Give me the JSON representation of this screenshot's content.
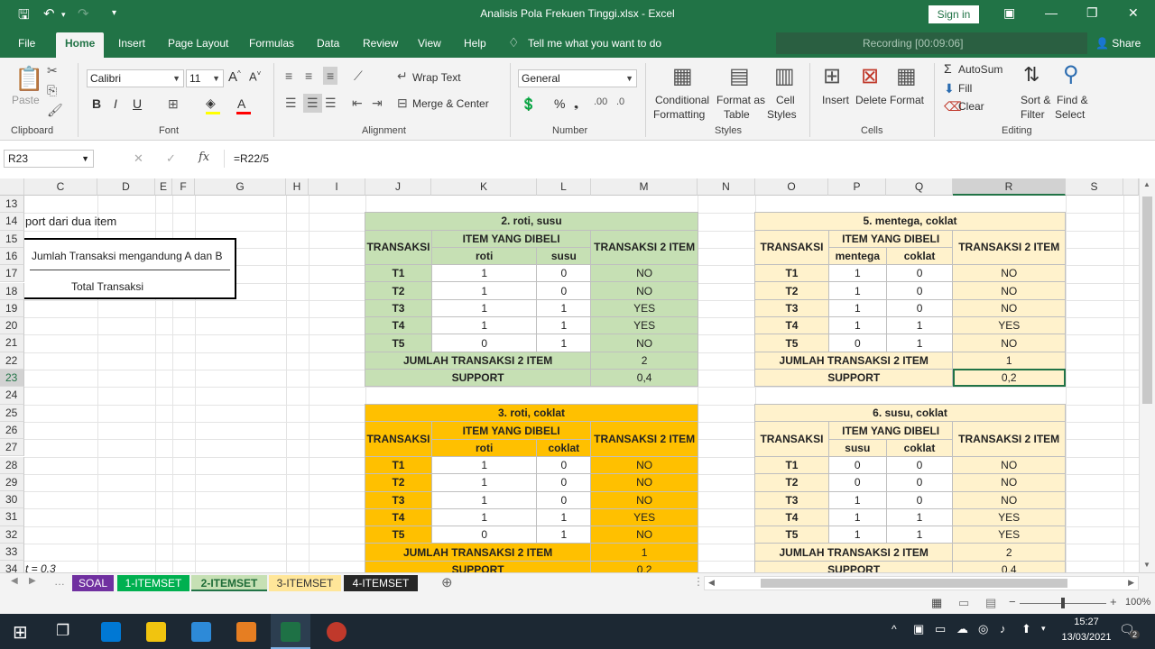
{
  "window": {
    "title": "Analisis Pola Frekuen Tinggi.xlsx  -  Excel",
    "signin": "Sign in"
  },
  "ribbon_tabs": [
    "File",
    "Home",
    "Insert",
    "Page Layout",
    "Formulas",
    "Data",
    "Review",
    "View",
    "Help"
  ],
  "tellme": "Tell me what you want to do",
  "recording": "Recording [00:09:06]",
  "share": "Share",
  "ribbon": {
    "paste": "Paste",
    "clipboard": "Clipboard",
    "font_name": "Calibri",
    "font_size": "11",
    "font": "Font",
    "wrap_text": "Wrap Text",
    "merge_center": "Merge & Center",
    "alignment": "Alignment",
    "number_format": "General",
    "number": "Number",
    "cond_format_1": "Conditional",
    "cond_format_2": "Formatting",
    "format_table_1": "Format as",
    "format_table_2": "Table",
    "cell_styles_1": "Cell",
    "cell_styles_2": "Styles",
    "styles": "Styles",
    "insert": "Insert",
    "delete": "Delete",
    "format": "Format",
    "cells": "Cells",
    "autosum": "AutoSum",
    "fill": "Fill",
    "clear": "Clear",
    "sort_filter_1": "Sort &",
    "sort_filter_2": "Filter",
    "find_select_1": "Find &",
    "find_select_2": "Select",
    "editing": "Editing"
  },
  "formula_bar": {
    "name_box": "R23",
    "fx": "fx",
    "formula": "=R22/5"
  },
  "columns": [
    "C",
    "D",
    "E",
    "F",
    "G",
    "H",
    "I",
    "J",
    "K",
    "L",
    "M",
    "N",
    "O",
    "P",
    "Q",
    "R",
    "S"
  ],
  "rows": [
    "13",
    "14",
    "15",
    "16",
    "17",
    "18",
    "19",
    "20",
    "21",
    "22",
    "23",
    "24",
    "25",
    "26",
    "27",
    "28",
    "29",
    "30",
    "31",
    "32",
    "33",
    "34"
  ],
  "side_text": {
    "row14": "port dari dua item",
    "numerator": "Jumlah Transaksi mengandung A dan B",
    "denominator": "Total Transaksi",
    "row34": "t  = 0,3"
  },
  "tables": [
    {
      "title": "2. roti, susu",
      "h_trans": "TRANSAKSI",
      "h_items": "ITEM YANG DIBELI",
      "h_result": "TRANSAKSI 2 ITEM",
      "item_a": "roti",
      "item_b": "susu",
      "rows": [
        [
          "T1",
          "1",
          "0",
          "NO"
        ],
        [
          "T2",
          "1",
          "0",
          "NO"
        ],
        [
          "T3",
          "1",
          "1",
          "YES"
        ],
        [
          "T4",
          "1",
          "1",
          "YES"
        ],
        [
          "T5",
          "0",
          "1",
          "NO"
        ]
      ],
      "sum_label": "JUMLAH TRANSAKSI 2 ITEM",
      "sum": "2",
      "support_label": "SUPPORT",
      "support": "0,4"
    },
    {
      "title": "5. mentega, coklat",
      "h_trans": "TRANSAKSI",
      "h_items": "ITEM YANG DIBELI",
      "h_result": "TRANSAKSI 2 ITEM",
      "item_a": "mentega",
      "item_b": "coklat",
      "rows": [
        [
          "T1",
          "1",
          "0",
          "NO"
        ],
        [
          "T2",
          "1",
          "0",
          "NO"
        ],
        [
          "T3",
          "1",
          "0",
          "NO"
        ],
        [
          "T4",
          "1",
          "1",
          "YES"
        ],
        [
          "T5",
          "0",
          "1",
          "NO"
        ]
      ],
      "sum_label": "JUMLAH TRANSAKSI 2 ITEM",
      "sum": "1",
      "support_label": "SUPPORT",
      "support": "0,2"
    },
    {
      "title": "3. roti, coklat",
      "h_trans": "TRANSAKSI",
      "h_items": "ITEM YANG DIBELI",
      "h_result": "TRANSAKSI 2 ITEM",
      "item_a": "roti",
      "item_b": "coklat",
      "rows": [
        [
          "T1",
          "1",
          "0",
          "NO"
        ],
        [
          "T2",
          "1",
          "0",
          "NO"
        ],
        [
          "T3",
          "1",
          "0",
          "NO"
        ],
        [
          "T4",
          "1",
          "1",
          "YES"
        ],
        [
          "T5",
          "0",
          "1",
          "NO"
        ]
      ],
      "sum_label": "JUMLAH TRANSAKSI 2 ITEM",
      "sum": "1",
      "support_label": "SUPPORT",
      "support": "0,2"
    },
    {
      "title": "6. susu, coklat",
      "h_trans": "TRANSAKSI",
      "h_items": "ITEM YANG DIBELI",
      "h_result": "TRANSAKSI 2 ITEM",
      "item_a": "susu",
      "item_b": "coklat",
      "rows": [
        [
          "T1",
          "0",
          "0",
          "NO"
        ],
        [
          "T2",
          "0",
          "0",
          "NO"
        ],
        [
          "T3",
          "1",
          "0",
          "NO"
        ],
        [
          "T4",
          "1",
          "1",
          "YES"
        ],
        [
          "T5",
          "1",
          "1",
          "YES"
        ]
      ],
      "sum_label": "JUMLAH TRANSAKSI 2 ITEM",
      "sum": "2",
      "support_label": "SUPPORT",
      "support": "0,4"
    }
  ],
  "sheet_tabs": [
    {
      "name": "SOAL",
      "color": "#7030a0"
    },
    {
      "name": "1-ITEMSET",
      "color": "#00b050"
    },
    {
      "name": "2-ITEMSET",
      "color": "#c6e0b4"
    },
    {
      "name": "3-ITEMSET",
      "color": "#ffe699"
    },
    {
      "name": "4-ITEMSET",
      "color": "#262626"
    }
  ],
  "status": {
    "zoom": "100%"
  },
  "taskbar": {
    "time": "15:27",
    "date": "13/03/2021",
    "notif": "2"
  }
}
